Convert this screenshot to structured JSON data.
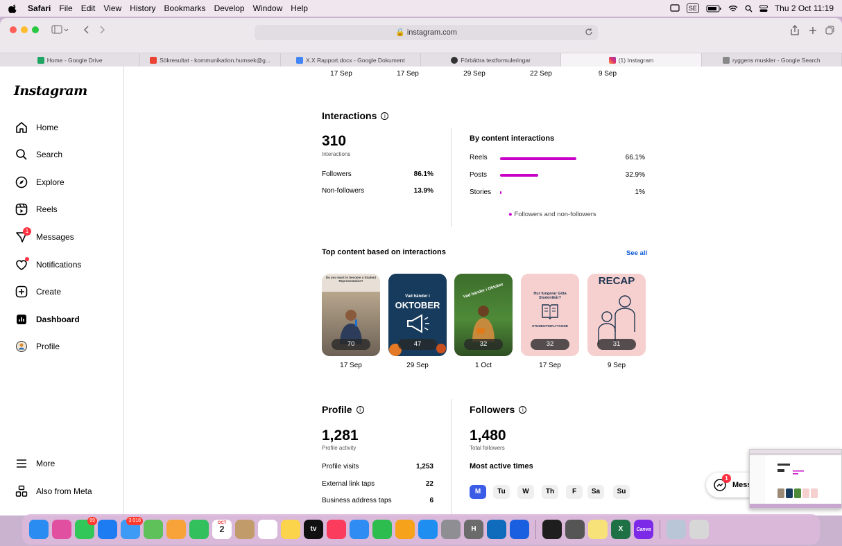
{
  "menubar": {
    "app": "Safari",
    "items": [
      "File",
      "Edit",
      "View",
      "History",
      "Bookmarks",
      "Develop",
      "Window",
      "Help"
    ],
    "input_source": "SE",
    "clock": "Thu 2 Oct  11:19"
  },
  "browser": {
    "url": "instagram.com",
    "tabs": [
      {
        "label": "Home - Google Drive",
        "color": "#1fa463"
      },
      {
        "label": "Sökresultat - kommunikation.humsek@g...",
        "color": "#ea4335"
      },
      {
        "label": "X.X Rapport.docx - Google Dokument",
        "color": "#4285f4"
      },
      {
        "label": "Förbättra textformuleringar",
        "color": "#333333"
      },
      {
        "label": "(1) Instagram",
        "color": "#e1306c"
      },
      {
        "label": "ryggens muskler - Google Search",
        "color": "#888888"
      }
    ]
  },
  "sidebar": {
    "logo": "Instagram",
    "items": [
      {
        "label": "Home",
        "icon": "home-icon"
      },
      {
        "label": "Search",
        "icon": "search-icon"
      },
      {
        "label": "Explore",
        "icon": "compass-icon"
      },
      {
        "label": "Reels",
        "icon": "reels-icon"
      },
      {
        "label": "Messages",
        "icon": "messenger-icon",
        "badge": "1"
      },
      {
        "label": "Notifications",
        "icon": "heart-icon"
      },
      {
        "label": "Create",
        "icon": "plus-square-icon"
      },
      {
        "label": "Dashboard",
        "icon": "dashboard-icon"
      },
      {
        "label": "Profile",
        "icon": "avatar-icon"
      }
    ],
    "bottom": [
      {
        "label": "More",
        "icon": "menu-icon"
      },
      {
        "label": "Also from Meta",
        "icon": "meta-apps-icon"
      }
    ]
  },
  "top_dates": [
    "17 Sep",
    "17 Sep",
    "29 Sep",
    "22 Sep",
    "9 Sep"
  ],
  "interactions": {
    "title": "Interactions",
    "total": "310",
    "total_label": "Interactions",
    "split": [
      {
        "label": "Followers",
        "value": "86.1%"
      },
      {
        "label": "Non-followers",
        "value": "13.9%"
      }
    ],
    "by_content_title": "By content interactions",
    "by_content": [
      {
        "label": "Reels",
        "value": "66.1%",
        "fraction": 0.661
      },
      {
        "label": "Posts",
        "value": "32.9%",
        "fraction": 0.329
      },
      {
        "label": "Stories",
        "value": "1%",
        "fraction": 0.01
      }
    ],
    "legend": "Followers and non-followers",
    "bar_color": "#c800c8"
  },
  "top_content": {
    "title": "Top content based on interactions",
    "see_all": "See all",
    "items": [
      {
        "count": "70",
        "date": "17 Sep",
        "text": "Do you want to become a Student Representative?"
      },
      {
        "count": "47",
        "date": "29 Sep",
        "text1": "Vad händer i",
        "text2": "OKTOBER"
      },
      {
        "count": "32",
        "date": "1 Oct",
        "text": "Vad händer i Oktober"
      },
      {
        "count": "32",
        "date": "17 Sep",
        "text1": "Hur fungerar Göta Studentkår?",
        "text2": "STUDENTINFLYTANDE"
      },
      {
        "count": "31",
        "date": "9 Sep",
        "text": "RECAP"
      }
    ]
  },
  "profile": {
    "title": "Profile",
    "total": "1,281",
    "total_label": "Profile activity",
    "rows": [
      {
        "label": "Profile visits",
        "value": "1,253"
      },
      {
        "label": "External link taps",
        "value": "22"
      },
      {
        "label": "Business address taps",
        "value": "6"
      }
    ]
  },
  "followers": {
    "title": "Followers",
    "total": "1,480",
    "total_label": "Total followers",
    "active_title": "Most active times",
    "days": [
      "M",
      "Tu",
      "W",
      "Th",
      "F",
      "Sa",
      "Su"
    ],
    "selected_day": "M",
    "accent": "#3b5ce6"
  },
  "messages_button": {
    "label": "Mess",
    "badge": "1"
  },
  "dock": {
    "apps": [
      {
        "name": "finder",
        "color": "#2a8cf0"
      },
      {
        "name": "launchpad",
        "color": "#e04fa0"
      },
      {
        "name": "messages",
        "color": "#32c759",
        "badge": "99"
      },
      {
        "name": "safari",
        "color": "#1e7cf2"
      },
      {
        "name": "mail",
        "color": "#3d9bf5",
        "badge": "3 018"
      },
      {
        "name": "maps",
        "color": "#5fc15a"
      },
      {
        "name": "photos",
        "color": "#f7a33a"
      },
      {
        "name": "facetime",
        "color": "#31c05b"
      },
      {
        "name": "calendar",
        "color": "#ffffff",
        "label": "2",
        "month": "OCT"
      },
      {
        "name": "contacts",
        "color": "#c29b6b"
      },
      {
        "name": "reminders",
        "color": "#ffffff"
      },
      {
        "name": "notes",
        "color": "#fbd44b"
      },
      {
        "name": "tv",
        "color": "#111111",
        "label": "tv"
      },
      {
        "name": "music",
        "color": "#fb3c5c"
      },
      {
        "name": "keynote",
        "color": "#2f8cf2"
      },
      {
        "name": "numbers",
        "color": "#2dbd4f"
      },
      {
        "name": "pages",
        "color": "#f7a21b"
      },
      {
        "name": "app-store",
        "color": "#1f8ef1"
      },
      {
        "name": "system-settings",
        "color": "#8e8e93"
      },
      {
        "name": "h-app",
        "color": "#6b6b6b",
        "label": "H"
      },
      {
        "name": "outlook",
        "color": "#0f6cbd"
      },
      {
        "name": "bitwarden",
        "color": "#1a5fe0"
      },
      {
        "name": "terminal",
        "color": "#1e1e1e"
      },
      {
        "name": "chess",
        "color": "#555555"
      },
      {
        "name": "stickies",
        "color": "#f7e27a"
      },
      {
        "name": "excel",
        "color": "#1e7145",
        "label": "X"
      },
      {
        "name": "canva",
        "color": "#7d2ae8",
        "label": "Canva"
      },
      {
        "name": "preview",
        "color": "#b9c6d8"
      },
      {
        "name": "trash",
        "color": "#d7d7d7"
      }
    ]
  }
}
